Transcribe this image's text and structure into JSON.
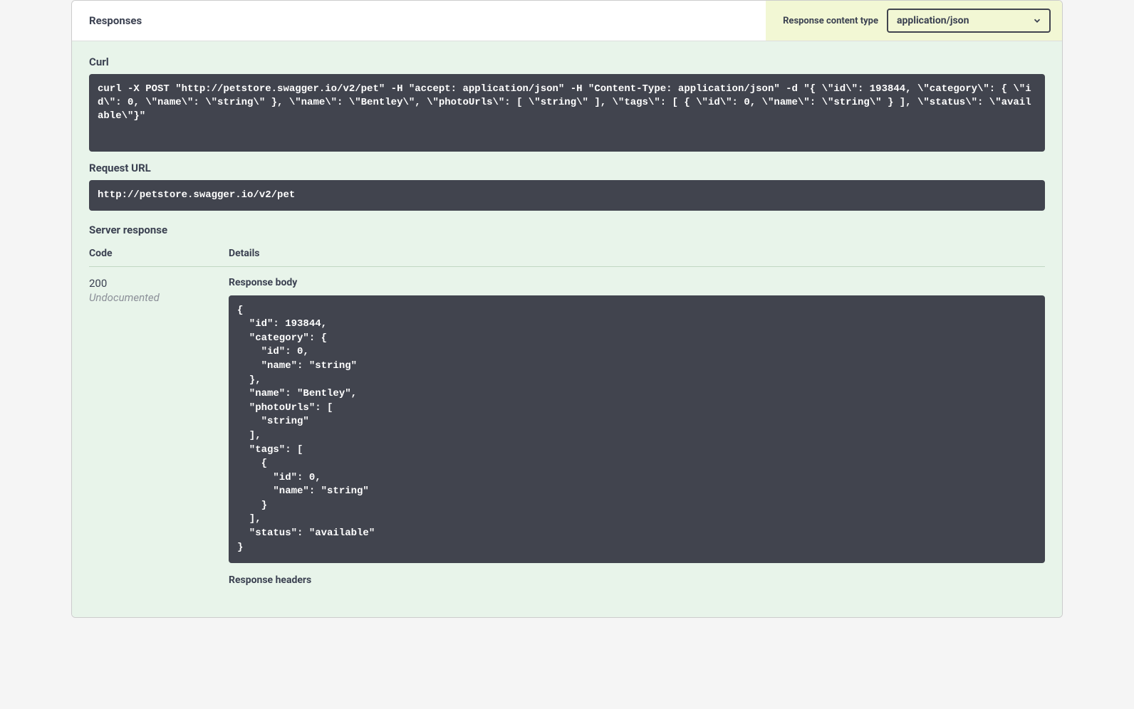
{
  "header": {
    "title": "Responses",
    "content_type_label": "Response content type",
    "content_type_value": "application/json"
  },
  "sections": {
    "curl_label": "Curl",
    "curl_value": "curl -X POST \"http://petstore.swagger.io/v2/pet\" -H \"accept: application/json\" -H \"Content-Type: application/json\" -d \"{ \\\"id\\\": 193844, \\\"category\\\": { \\\"id\\\": 0, \\\"name\\\": \\\"string\\\" }, \\\"name\\\": \\\"Bentley\\\", \\\"photoUrls\\\": [ \\\"string\\\" ], \\\"tags\\\": [ { \\\"id\\\": 0, \\\"name\\\": \\\"string\\\" } ], \\\"status\\\": \\\"available\\\"}\"",
    "request_url_label": "Request URL",
    "request_url_value": "http://petstore.swagger.io/v2/pet",
    "server_response_label": "Server response",
    "code_header": "Code",
    "details_header": "Details"
  },
  "response": {
    "code": "200",
    "undocumented": "Undocumented",
    "body_label": "Response body",
    "body_value": "{\n  \"id\": 193844,\n  \"category\": {\n    \"id\": 0,\n    \"name\": \"string\"\n  },\n  \"name\": \"Bentley\",\n  \"photoUrls\": [\n    \"string\"\n  ],\n  \"tags\": [\n    {\n      \"id\": 0,\n      \"name\": \"string\"\n    }\n  ],\n  \"status\": \"available\"\n}",
    "headers_label": "Response headers"
  }
}
